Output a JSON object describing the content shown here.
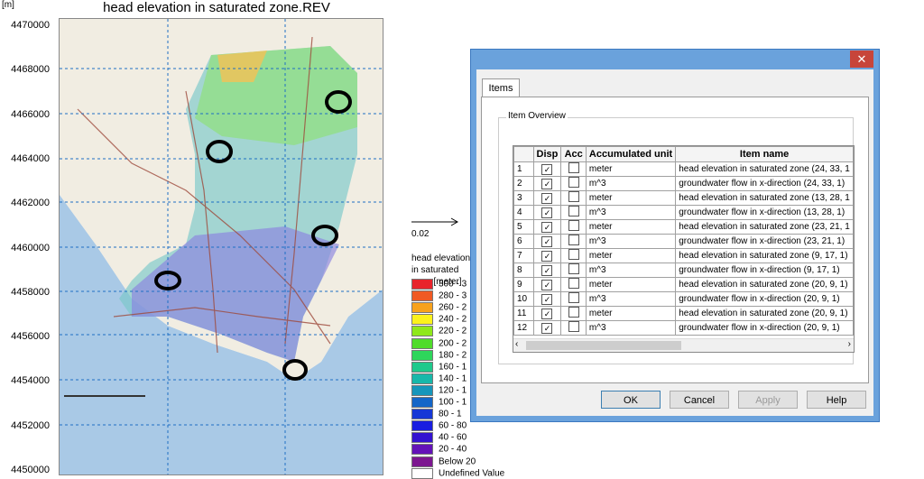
{
  "plot": {
    "title": "head elevation in saturated zone.REV",
    "unit": "[m]",
    "yticks": [
      "4470000",
      "4468000",
      "4466000",
      "4464000",
      "4462000",
      "4460000",
      "4458000",
      "4456000",
      "4454000",
      "4452000",
      "4450000"
    ]
  },
  "vector_scale": "0.02",
  "legend": {
    "title": "head elevation in saturated zone [meter]",
    "items": [
      {
        "label": "300 - 3",
        "color": "#e8232b"
      },
      {
        "label": "280 - 3",
        "color": "#f05a24"
      },
      {
        "label": "260 - 2",
        "color": "#f7a21c"
      },
      {
        "label": "240 - 2",
        "color": "#fbf21b"
      },
      {
        "label": "220 - 2",
        "color": "#8fe81a"
      },
      {
        "label": "200 - 2",
        "color": "#4fdc2a"
      },
      {
        "label": "180 - 2",
        "color": "#2ed65b"
      },
      {
        "label": "160 - 1",
        "color": "#1fc98c"
      },
      {
        "label": "140 - 1",
        "color": "#17b8aa"
      },
      {
        "label": "120 - 1",
        "color": "#1696bb"
      },
      {
        "label": "100 - 1",
        "color": "#1466c8"
      },
      {
        "label": "80 - 1",
        "color": "#1637d6"
      },
      {
        "label": "60 - 80",
        "color": "#1a1ee0"
      },
      {
        "label": "40 - 60",
        "color": "#3412d0"
      },
      {
        "label": "20 - 40",
        "color": "#6412b8"
      },
      {
        "label": "Below 20",
        "color": "#7c1690"
      },
      {
        "label": "Undefined Value",
        "color": "#ffffff"
      }
    ]
  },
  "dialog": {
    "close_glyph": "✕",
    "tab_label": "Items",
    "group_label": "Item Overview",
    "columns": [
      "",
      "Disp",
      "Acc",
      "Accumulated unit",
      "Item name"
    ],
    "rows": [
      {
        "num": "1",
        "unit": "meter",
        "name": "head elevation in saturated zone (24, 33, 1"
      },
      {
        "num": "2",
        "unit": "m^3",
        "name": "groundwater flow in x-direction (24, 33, 1)"
      },
      {
        "num": "3",
        "unit": "meter",
        "name": "head elevation in saturated zone (13, 28, 1"
      },
      {
        "num": "4",
        "unit": "m^3",
        "name": "groundwater flow in x-direction (13, 28, 1)"
      },
      {
        "num": "5",
        "unit": "meter",
        "name": "head elevation in saturated zone (23, 21, 1"
      },
      {
        "num": "6",
        "unit": "m^3",
        "name": "groundwater flow in x-direction (23, 21, 1)"
      },
      {
        "num": "7",
        "unit": "meter",
        "name": "head elevation in saturated zone (9, 17, 1)"
      },
      {
        "num": "8",
        "unit": "m^3",
        "name": "groundwater flow in x-direction (9, 17, 1)"
      },
      {
        "num": "9",
        "unit": "meter",
        "name": "head elevation in saturated zone (20, 9, 1)"
      },
      {
        "num": "10",
        "unit": "m^3",
        "name": "groundwater flow in x-direction (20, 9, 1)"
      },
      {
        "num": "11",
        "unit": "meter",
        "name": "head elevation in saturated zone (20, 9, 1)"
      },
      {
        "num": "12",
        "unit": "m^3",
        "name": "groundwater flow in x-direction (20, 9, 1)"
      }
    ],
    "buttons": {
      "ok": "OK",
      "cancel": "Cancel",
      "apply": "Apply",
      "help": "Help"
    }
  }
}
